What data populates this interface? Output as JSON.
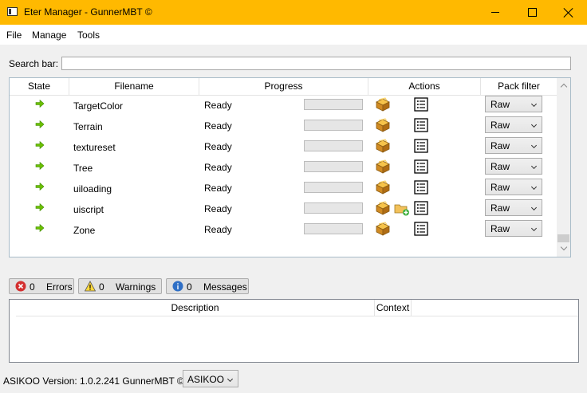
{
  "window": {
    "title": "Eter Manager - GunnerMBT ©"
  },
  "menu": {
    "items": [
      "File",
      "Manage",
      "Tools"
    ]
  },
  "search": {
    "label": "Search bar:",
    "value": ""
  },
  "grid": {
    "columns": [
      "State",
      "Filename",
      "Progress",
      "Actions",
      "Pack filter"
    ],
    "rows": [
      {
        "filename": "TargetColor",
        "status": "Ready",
        "progress": 0,
        "filter": "Raw",
        "extra_action": false
      },
      {
        "filename": "Terrain",
        "status": "Ready",
        "progress": 0,
        "filter": "Raw",
        "extra_action": false
      },
      {
        "filename": "textureset",
        "status": "Ready",
        "progress": 0,
        "filter": "Raw",
        "extra_action": false
      },
      {
        "filename": "Tree",
        "status": "Ready",
        "progress": 0,
        "filter": "Raw",
        "extra_action": false
      },
      {
        "filename": "uiloading",
        "status": "Ready",
        "progress": 0,
        "filter": "Raw",
        "extra_action": false
      },
      {
        "filename": "uiscript",
        "status": "Ready",
        "progress": 0,
        "filter": "Raw",
        "extra_action": true
      },
      {
        "filename": "Zone",
        "status": "Ready",
        "progress": 0,
        "filter": "Raw",
        "extra_action": false
      }
    ]
  },
  "log_tabs": {
    "errors": {
      "count": "0",
      "label": "Errors"
    },
    "warnings": {
      "count": "0",
      "label": "Warnings"
    },
    "messages": {
      "count": "0",
      "label": "Messages"
    }
  },
  "log_table": {
    "columns": [
      "Description",
      "Context"
    ]
  },
  "statusbar": {
    "text": "ASIKOO  Version: 1.0.2.241 GunnerMBT ©",
    "combo_value": "ASIKOO"
  },
  "colors": {
    "titlebar": "#ffb900",
    "state_arrow": "#6cc000",
    "progress_fill": "#06b025"
  }
}
